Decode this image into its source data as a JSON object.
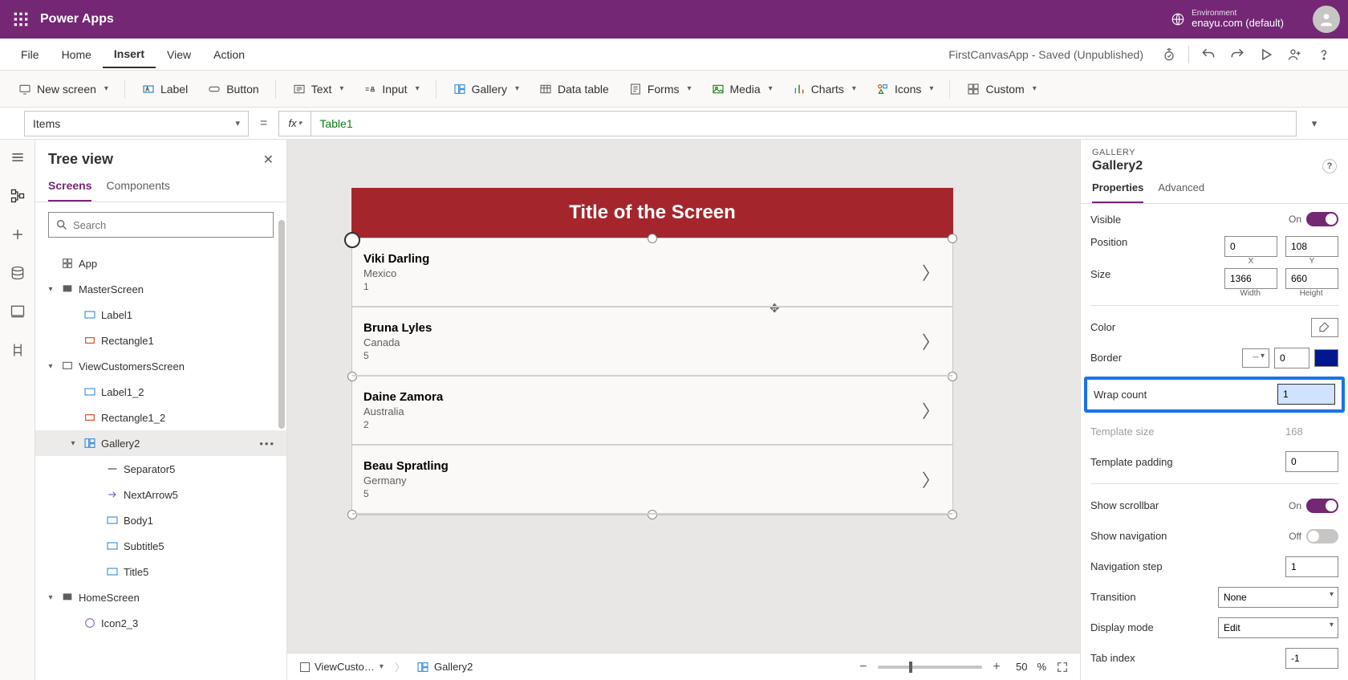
{
  "appbar": {
    "brand": "Power Apps",
    "env_label": "Environment",
    "env_name": "enayu.com (default)"
  },
  "menubar": {
    "items": [
      "File",
      "Home",
      "Insert",
      "View",
      "Action"
    ],
    "active_index": 2,
    "doc_status": "FirstCanvasApp - Saved (Unpublished)"
  },
  "ribbon": {
    "new_screen": "New screen",
    "label": "Label",
    "button": "Button",
    "text": "Text",
    "input": "Input",
    "gallery": "Gallery",
    "data_table": "Data table",
    "forms": "Forms",
    "media": "Media",
    "charts": "Charts",
    "icons": "Icons",
    "custom": "Custom"
  },
  "formula": {
    "property": "Items",
    "fx": "fx",
    "value": "Table1"
  },
  "tree": {
    "title": "Tree view",
    "tabs": [
      "Screens",
      "Components"
    ],
    "active_tab": 0,
    "search_placeholder": "Search",
    "nodes": [
      {
        "label": "App",
        "icon": "app",
        "depth": 0,
        "expand": ""
      },
      {
        "label": "MasterScreen",
        "icon": "screen-dark",
        "depth": 0,
        "expand": "▾"
      },
      {
        "label": "Label1",
        "icon": "label",
        "depth": 1,
        "expand": ""
      },
      {
        "label": "Rectangle1",
        "icon": "rect",
        "depth": 1,
        "expand": ""
      },
      {
        "label": "ViewCustomersScreen",
        "icon": "screen",
        "depth": 0,
        "expand": "▾"
      },
      {
        "label": "Label1_2",
        "icon": "label",
        "depth": 1,
        "expand": ""
      },
      {
        "label": "Rectangle1_2",
        "icon": "rect",
        "depth": 1,
        "expand": ""
      },
      {
        "label": "Gallery2",
        "icon": "gallery",
        "depth": 1,
        "expand": "▾",
        "selected": true,
        "more": true
      },
      {
        "label": "Separator5",
        "icon": "sep",
        "depth": 2,
        "expand": ""
      },
      {
        "label": "NextArrow5",
        "icon": "arrow",
        "depth": 2,
        "expand": ""
      },
      {
        "label": "Body1",
        "icon": "label",
        "depth": 2,
        "expand": ""
      },
      {
        "label": "Subtitle5",
        "icon": "label",
        "depth": 2,
        "expand": ""
      },
      {
        "label": "Title5",
        "icon": "label",
        "depth": 2,
        "expand": ""
      },
      {
        "label": "HomeScreen",
        "icon": "screen-dark",
        "depth": 0,
        "expand": "▾"
      },
      {
        "label": "Icon2_3",
        "icon": "icon",
        "depth": 1,
        "expand": ""
      }
    ]
  },
  "canvas": {
    "screen_title": "Title of the Screen",
    "gallery_items": [
      {
        "name": "Viki  Darling",
        "country": "Mexico",
        "num": "1"
      },
      {
        "name": "Bruna  Lyles",
        "country": "Canada",
        "num": "5"
      },
      {
        "name": "Daine  Zamora",
        "country": "Australia",
        "num": "2"
      },
      {
        "name": "Beau  Spratling",
        "country": "Germany",
        "num": "5"
      }
    ]
  },
  "breadcrumb": {
    "screen": "ViewCusto…",
    "control": "Gallery2"
  },
  "zoom": {
    "value": "50",
    "unit": "%"
  },
  "props": {
    "kind": "GALLERY",
    "name": "Gallery2",
    "tabs": [
      "Properties",
      "Advanced"
    ],
    "active_tab": 0,
    "visible": {
      "label": "Visible",
      "state": "On"
    },
    "position": {
      "label": "Position",
      "x": "0",
      "y": "108",
      "xl": "X",
      "yl": "Y"
    },
    "size": {
      "label": "Size",
      "w": "1366",
      "h": "660",
      "wl": "Width",
      "hl": "Height"
    },
    "color": {
      "label": "Color"
    },
    "border": {
      "label": "Border",
      "width": "0",
      "color": "#00188f"
    },
    "wrap_count": {
      "label": "Wrap count",
      "value": "1"
    },
    "template_size": {
      "label": "Template size",
      "value": "168"
    },
    "template_padding": {
      "label": "Template padding",
      "value": "0"
    },
    "show_scrollbar": {
      "label": "Show scrollbar",
      "state": "On"
    },
    "show_navigation": {
      "label": "Show navigation",
      "state": "Off"
    },
    "navigation_step": {
      "label": "Navigation step",
      "value": "1"
    },
    "transition": {
      "label": "Transition",
      "value": "None"
    },
    "display_mode": {
      "label": "Display mode",
      "value": "Edit"
    },
    "tab_index": {
      "label": "Tab index",
      "value": "-1"
    }
  }
}
